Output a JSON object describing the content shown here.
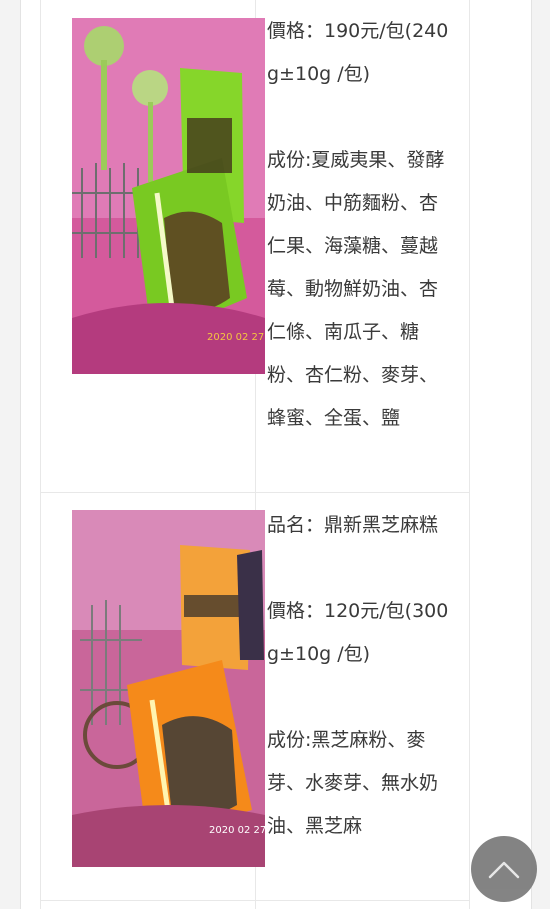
{
  "products": [
    {
      "name_line": "",
      "price_lines": [
        "價格：190元/包(240",
        "g±10g /包)"
      ],
      "ingredient_lines": [
        "成份:夏威夷果、發酵",
        "奶油、中筋麵粉、杏",
        "仁果、海藻糖、蔓越",
        "莓、動物鮮奶油、杏",
        "仁條、南瓜子、糖",
        "粉、杏仁粉、麥芽、",
        "蜂蜜、全蛋、鹽"
      ],
      "photo": {
        "date_stamp": "2020 02 27",
        "bag_color": "#7ed321",
        "background": "#d9589a"
      }
    },
    {
      "name_line": "品名：鼎新黑芝麻糕",
      "price_lines": [
        "價格：120元/包(300",
        "g±10g /包)"
      ],
      "ingredient_lines": [
        "成份:黑芝麻粉、麥",
        "芽、水麥芽、無水奶",
        "油、黑芝麻"
      ],
      "photo": {
        "date_stamp": "2020 02 27",
        "bag_color": "#f6901e",
        "background": "#c9669a"
      }
    }
  ],
  "scroll_top": {
    "icon": "chevron-up-icon"
  }
}
